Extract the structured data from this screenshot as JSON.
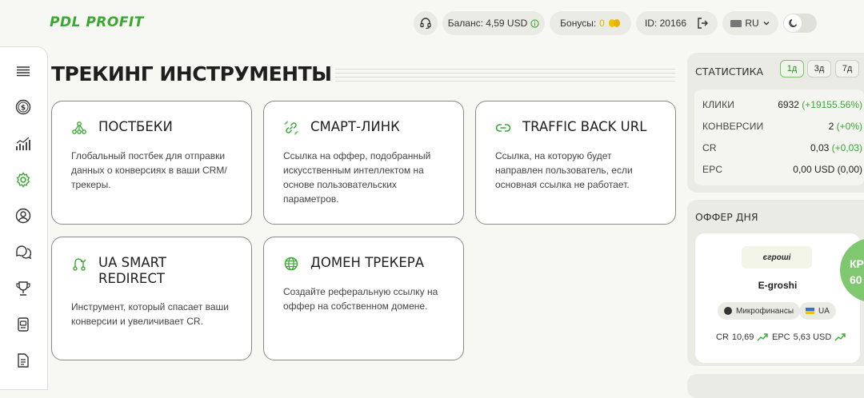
{
  "header": {
    "logo": "PDL PROFIT",
    "balance_label": "Баланс: 4,59 USD",
    "bonus_label": "Бонусы:",
    "bonus_value": "0",
    "id_label": "ID: 20166",
    "language": "RU"
  },
  "sidebar": {
    "items": [
      {
        "icon": "menu-icon"
      },
      {
        "icon": "dollar-coin-icon"
      },
      {
        "icon": "bar-chart-icon"
      },
      {
        "icon": "gear-icon"
      },
      {
        "icon": "user-icon"
      },
      {
        "icon": "support-chat-icon"
      },
      {
        "icon": "trophy-icon"
      },
      {
        "icon": "wallet-icon"
      },
      {
        "icon": "document-icon"
      }
    ],
    "active_color": "#3aa832"
  },
  "page": {
    "title": "ТРЕКИНГ ИНСТРУМЕНТЫ"
  },
  "cards": [
    {
      "title": "ПОСТБЕКИ",
      "desc": "Глобальный постбек для отправки данных о конверсиях в ваши CRM/ трекеры.",
      "icon": "network-nodes-icon"
    },
    {
      "title": "СМАРТ-ЛИНК",
      "desc": "Ссылка на оффер, подобранный искусственным интеллектом на основе пользовательских параметров.",
      "icon": "smart-link-icon"
    },
    {
      "title": "TRAFFIC BACK URL",
      "desc": "Ссылка, на которую будет направлен пользователь, если основная ссылка не работает.",
      "icon": "link-icon"
    },
    {
      "title": "UA SMART REDIRECT",
      "desc": "Инструмент, который спасает ваши конверсии и увеличивает CR.",
      "icon": "redirect-icon"
    },
    {
      "title": "ДОМЕН ТРЕКЕРА",
      "desc": "Создайте реферальную ссылку на оффер на собственном домене.",
      "icon": "globe-icon"
    }
  ],
  "stats": {
    "title": "СТАТИСТИКА",
    "periods": [
      "1д",
      "3д",
      "7д"
    ],
    "active_period": "1д",
    "rows": [
      {
        "label": "КЛИКИ",
        "value": "6932",
        "delta": "(+19155.56%)"
      },
      {
        "label": "КОНВЕРСИИ",
        "value": "2",
        "delta": "(+0%)"
      },
      {
        "label": "CR",
        "value": "0,03",
        "delta": "(+0,03)"
      },
      {
        "label": "EPC",
        "value": "0,00 USD",
        "delta": "(0,00)"
      }
    ]
  },
  "offer": {
    "title": "ОФФЕР ДНЯ",
    "logo_text": "єгроші",
    "name": "E-groshi",
    "category": "Микрофинансы",
    "country": "UA",
    "cr_label": "CR",
    "cr_value": "10,69",
    "epc_label": "EPC",
    "epc_value": "5,63 USD",
    "badge_line1": "КР",
    "badge_line2": "60"
  }
}
